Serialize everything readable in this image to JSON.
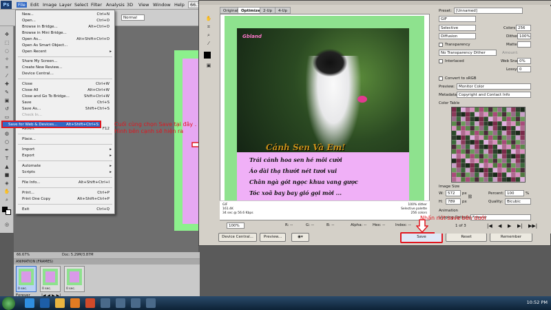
{
  "menubar": {
    "app_logo": "Ps",
    "items": [
      "File",
      "Edit",
      "Image",
      "Layer",
      "Select",
      "Filter",
      "Analysis",
      "3D",
      "View",
      "Window",
      "Help"
    ],
    "zoom": "66.7"
  },
  "options_bar": {
    "mode_value": "Normal"
  },
  "file_menu": {
    "items": [
      {
        "label": "New...",
        "shortcut": "Ctrl+N"
      },
      {
        "label": "Open...",
        "shortcut": "Ctrl+O"
      },
      {
        "label": "Browse in Bridge...",
        "shortcut": "Alt+Ctrl+O"
      },
      {
        "label": "Browse in Mini Bridge...",
        "shortcut": ""
      },
      {
        "label": "Open As...",
        "shortcut": "Alt+Shift+Ctrl+O"
      },
      {
        "label": "Open As Smart Object...",
        "shortcut": ""
      },
      {
        "label": "Open Recent",
        "shortcut": ""
      },
      {
        "label": "Share My Screen...",
        "shortcut": ""
      },
      {
        "label": "Create New Review...",
        "shortcut": ""
      },
      {
        "label": "Device Central...",
        "shortcut": ""
      },
      {
        "label": "Close",
        "shortcut": "Ctrl+W"
      },
      {
        "label": "Close All",
        "shortcut": "Alt+Ctrl+W"
      },
      {
        "label": "Close and Go To Bridge...",
        "shortcut": "Shift+Ctrl+W"
      },
      {
        "label": "Save",
        "shortcut": "Ctrl+S"
      },
      {
        "label": "Save As...",
        "shortcut": "Shift+Ctrl+S"
      },
      {
        "label": "Check In...",
        "shortcut": ""
      },
      {
        "label": "Save for Web & Devices...",
        "shortcut": "Alt+Shift+Ctrl+S"
      },
      {
        "label": "Revert",
        "shortcut": "F12"
      },
      {
        "label": "Place...",
        "shortcut": ""
      },
      {
        "label": "Import",
        "shortcut": ""
      },
      {
        "label": "Export",
        "shortcut": ""
      },
      {
        "label": "Automate",
        "shortcut": ""
      },
      {
        "label": "Scripts",
        "shortcut": ""
      },
      {
        "label": "File Info...",
        "shortcut": "Alt+Shift+Ctrl+I"
      },
      {
        "label": "Print...",
        "shortcut": "Ctrl+P"
      },
      {
        "label": "Print One Copy",
        "shortcut": "Alt+Shift+Ctrl+P"
      },
      {
        "label": "Exit",
        "shortcut": "Ctrl+Q"
      }
    ]
  },
  "annotations": {
    "note1": "Cuối cùng chọn Save tại đây . Hình bên cạnh sẽ hiện ra",
    "note2": "Nhấn nút save bên dưới"
  },
  "dialog": {
    "tabs": [
      "Original",
      "Optimized",
      "2-Up",
      "4-Up"
    ],
    "preview": {
      "logo": "Gbland",
      "title": "Cánh Sen Và Em!",
      "poem": [
        "Trái cánh hoa sen hé môi cười",
        "Áo dài thạ thướt nét tươi vui",
        "Chân ngà gót ngọc khua vang gược",
        "Tóc xoã bay bay gió gọi mời ..."
      ]
    },
    "status": {
      "format": "GIF",
      "size": "161.4K",
      "time": "34 sec @ 56.6 Kbps",
      "dither": "100% dither",
      "palette": "Selective palette",
      "colors": "256 colors"
    },
    "zoom": "100%",
    "readouts": {
      "r": "R: --",
      "g": "G: --",
      "b": "B: --",
      "alpha": "Alpha: --",
      "hex": "Hex: --",
      "index": "Index: --"
    },
    "buttons": {
      "device_central": "Device Central...",
      "preview": "Preview...",
      "save": "Save",
      "reset": "Reset",
      "remember": "Remember"
    },
    "settings": {
      "preset_label": "Preset:",
      "preset_value": "[Unnamed]",
      "format_value": "GIF",
      "reduction_value": "Selective",
      "colors_label": "Colors:",
      "colors_value": "256",
      "dither_algo": "Diffusion",
      "dither_label": "Dither:",
      "dither_value": "100%",
      "transparency": "Transparency",
      "matte_label": "Matte:",
      "trans_dither": "No Transparency Dither",
      "amount_label": "Amount:",
      "interlaced": "Interlaced",
      "websnap_label": "Web Snap:",
      "websnap_value": "0%",
      "lossy_label": "Lossy:",
      "lossy_value": "0",
      "convert_srgb": "Convert to sRGB",
      "preview_label": "Preview:",
      "preview_value": "Monitor Color",
      "metadata_label": "Metadata:",
      "metadata_value": "Copyright and Contact Info",
      "color_table": "Color Table",
      "image_size": "Image Size",
      "w_label": "W:",
      "w_value": "572",
      "h_label": "H:",
      "h_value": "789",
      "px": "px",
      "percent_label": "Percent:",
      "percent_value": "100",
      "percent_unit": "%",
      "quality_label": "Quality:",
      "quality_value": "Bicubic",
      "animation": "Animation",
      "looping_label": "Looping Options:",
      "looping_value": "Forever",
      "frame_counter": "1 of 3"
    }
  },
  "doc_status": {
    "zoom": "66.67%",
    "doc": "Doc: 5.29M/3.87M"
  },
  "animation_panel": {
    "title": "ANIMATION (FRAMES)",
    "frames": [
      {
        "num": "1",
        "time": "0 sec."
      },
      {
        "num": "2",
        "time": "0 sec."
      },
      {
        "num": "3",
        "time": "0 sec."
      }
    ],
    "looping": "Forever"
  },
  "taskbar": {
    "clock": "10:52 PM",
    "colors": {
      "ps": "#1d5ea8",
      "ie": "#2f8ee0",
      "folder": "#e8b440",
      "chrome": "#d04a2a",
      "media": "#e27b22"
    }
  }
}
